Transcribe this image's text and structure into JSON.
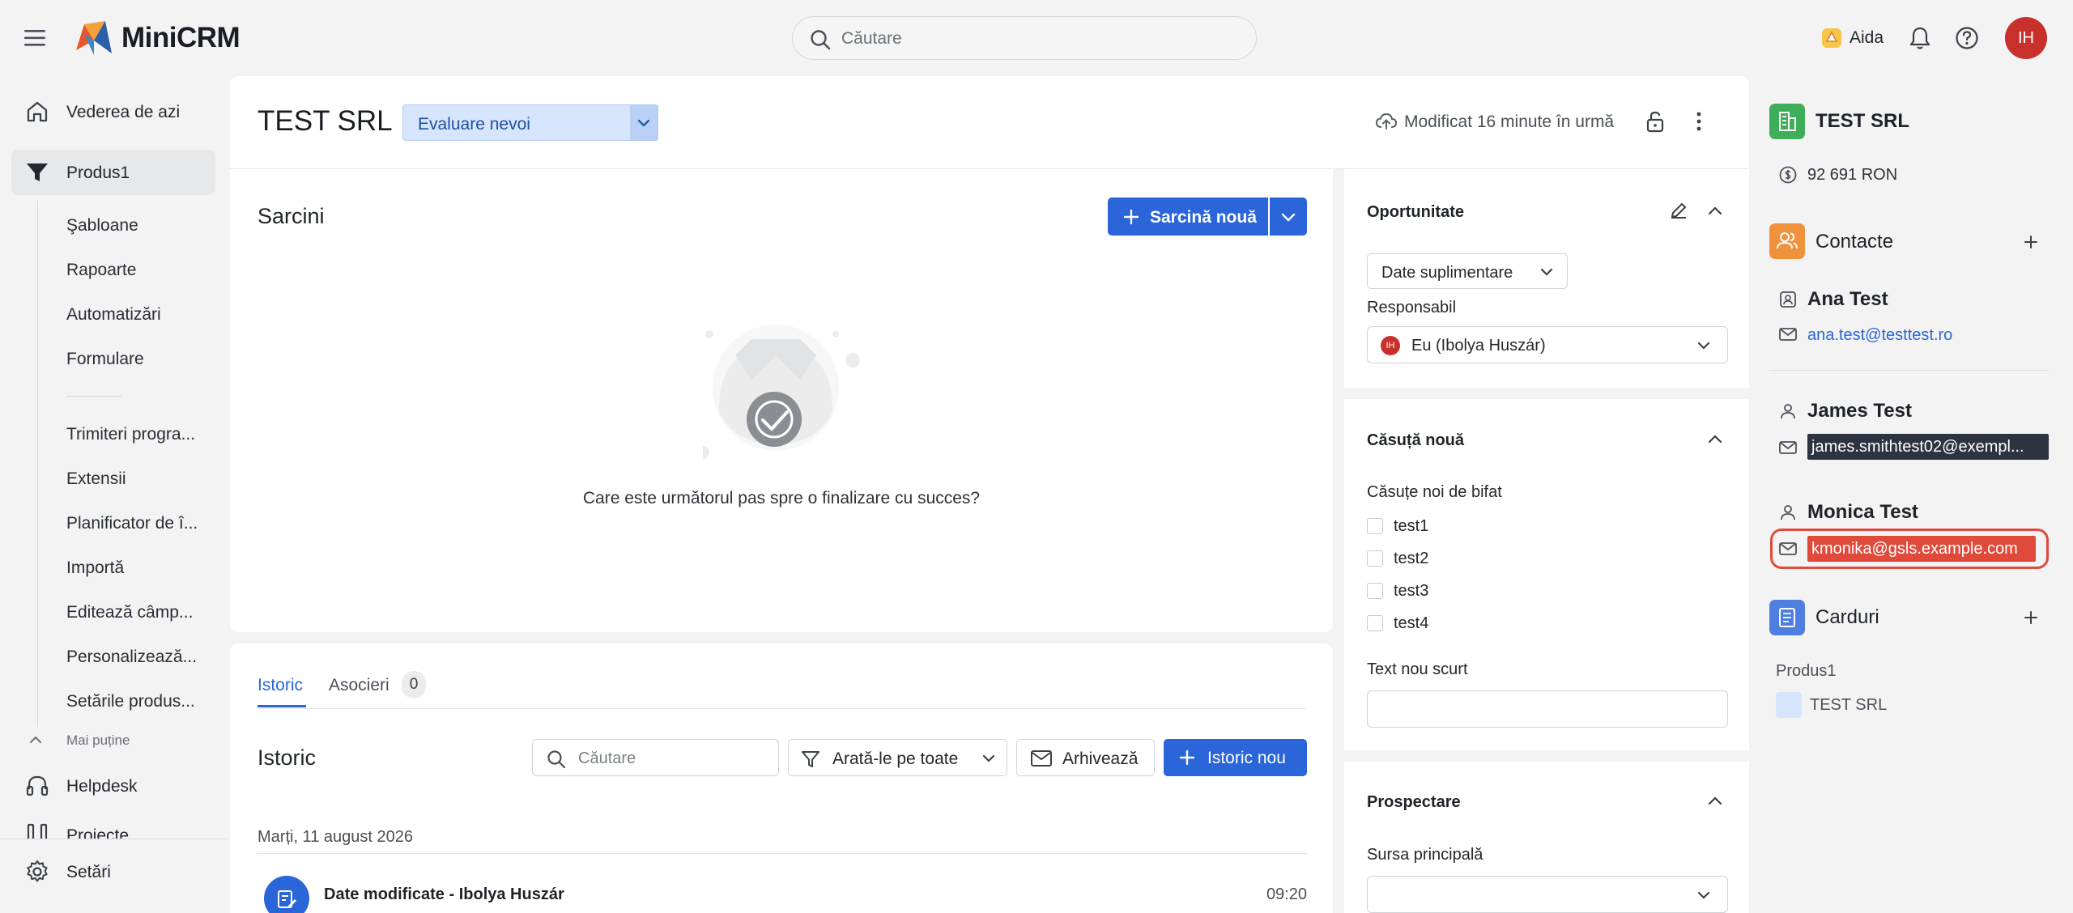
{
  "header": {
    "app_name": "MiniCRM",
    "search_placeholder": "Căutare",
    "assistant_label": "Aida",
    "avatar_initials": "IH"
  },
  "sidebar": {
    "main_items": [
      {
        "label": "Vederea de azi",
        "icon": "home-icon"
      },
      {
        "label": "Produs1",
        "icon": "funnel-icon"
      }
    ],
    "sub_items": [
      "Şabloane",
      "Rapoarte",
      "Automatizări",
      "Formulare",
      "Trimiteri progra...",
      "Extensii",
      "Planificator de î...",
      "Importă",
      "Editează câmp...",
      "Personalizează...",
      "Setările produs..."
    ],
    "less_label": "Mai puține",
    "helpdesk_label": "Helpdesk",
    "projects_label": "Proiecte",
    "settings_label": "Setări"
  },
  "record": {
    "title": "TEST SRL",
    "status": "Evaluare nevoi",
    "modified": "Modificat 16 minute în urmă"
  },
  "tasks": {
    "title": "Sarcini",
    "new_task": "Sarcină nouă",
    "empty_text": "Care este următorul pas spre o finalizare cu succes?"
  },
  "history": {
    "tabs": [
      {
        "label": "Istoric"
      },
      {
        "label": "Asocieri",
        "count": "0"
      }
    ],
    "title": "Istoric",
    "search_placeholder": "Căutare",
    "filter_label": "Arată-le pe toate",
    "archive_label": "Arhivează",
    "new_label": "Istoric nou",
    "date_heading": "Marți, 11 august 2026",
    "entries": [
      {
        "title": "Date modificate - Ibolya Huszár",
        "time": "09:20"
      }
    ]
  },
  "opportunity": {
    "title": "Oportunitate",
    "extra_data": "Date suplimentare",
    "responsible_label": "Responsabil",
    "responsible_initials": "IH",
    "responsible_value": "Eu (Ibolya Huszár)"
  },
  "new_box": {
    "title": "Căsuță nouă",
    "checkbox_group_label": "Căsuțe noi de bifat",
    "checkboxes": [
      "test1",
      "test2",
      "test3",
      "test4"
    ],
    "short_text_label": "Text nou scurt"
  },
  "prospecting": {
    "title": "Prospectare",
    "main_source_label": "Sursa principală"
  },
  "right_panel": {
    "company_name": "TEST SRL",
    "amount": "92 691 RON",
    "contacts_title": "Contacte",
    "contacts": [
      {
        "name": "Ana Test",
        "email": "ana.test@testtest.ro"
      },
      {
        "name": "James Test",
        "email": "james.smithtest02@exempl..."
      },
      {
        "name": "Monica Test",
        "email": "kmonika@gsls.example.com"
      }
    ],
    "cards_title": "Carduri",
    "card_product": "Produs1",
    "card_item": "TEST SRL"
  },
  "colors": {
    "accent": "#2a66d9",
    "status_bg": "#d6e5fb",
    "avatar": "#c8302c",
    "company_icon": "#3fae5b",
    "contacts_icon": "#f0923b",
    "cards_icon": "#4d7ee0",
    "highlight_dark": "#2d3340",
    "highlight_red": "#e04a3a"
  }
}
